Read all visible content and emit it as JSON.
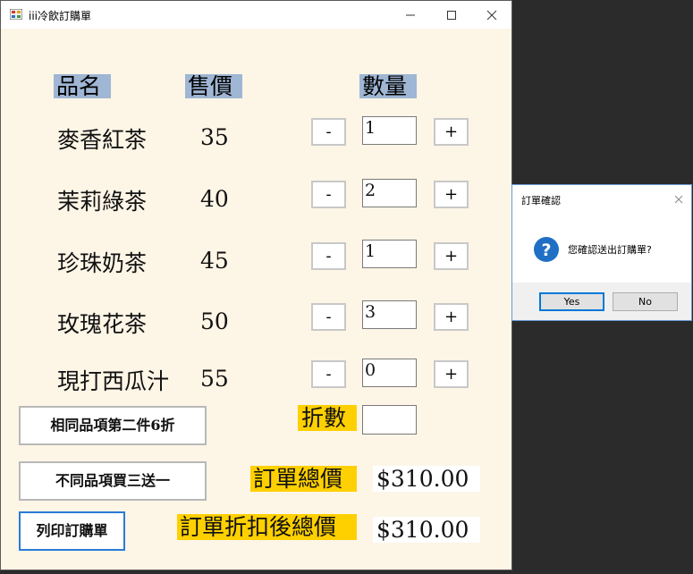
{
  "window": {
    "title": "iii冷飲訂購單"
  },
  "headers": {
    "name": "品名",
    "price": "售價",
    "quantity": "數量"
  },
  "items": [
    {
      "name": "麥香紅茶",
      "price": "35",
      "qty": "1",
      "minus": "-",
      "plus": "+"
    },
    {
      "name": "茉莉綠茶",
      "price": "40",
      "qty": "2",
      "minus": "-",
      "plus": "+"
    },
    {
      "name": "珍珠奶茶",
      "price": "45",
      "qty": "1",
      "minus": "-",
      "plus": "+"
    },
    {
      "name": "玫瑰花茶",
      "price": "50",
      "qty": "3",
      "minus": "-",
      "plus": "+"
    },
    {
      "name": "現打西瓜汁",
      "price": "55",
      "qty": "0",
      "minus": "-",
      "plus": "+"
    }
  ],
  "buttons": {
    "second_item_discount": "相同品項第二件6折",
    "buy3_get1": "不同品項買三送一",
    "print_order": "列印訂購單"
  },
  "discount": {
    "label": "折數",
    "value": ""
  },
  "totals": {
    "total_label": "訂單總價",
    "total_value": "$310.00",
    "discounted_label": "訂單折扣後總價",
    "discounted_value": "$310.00"
  },
  "dialog": {
    "title": "訂單確認",
    "message": "您確認送出訂購單?",
    "yes": "Yes",
    "no": "No"
  },
  "colors": {
    "form_bg": "#fdf5e6",
    "header_bg": "#9fb6d4",
    "highlight": "#ffd000",
    "dialog_icon": "#1f6fc5"
  }
}
